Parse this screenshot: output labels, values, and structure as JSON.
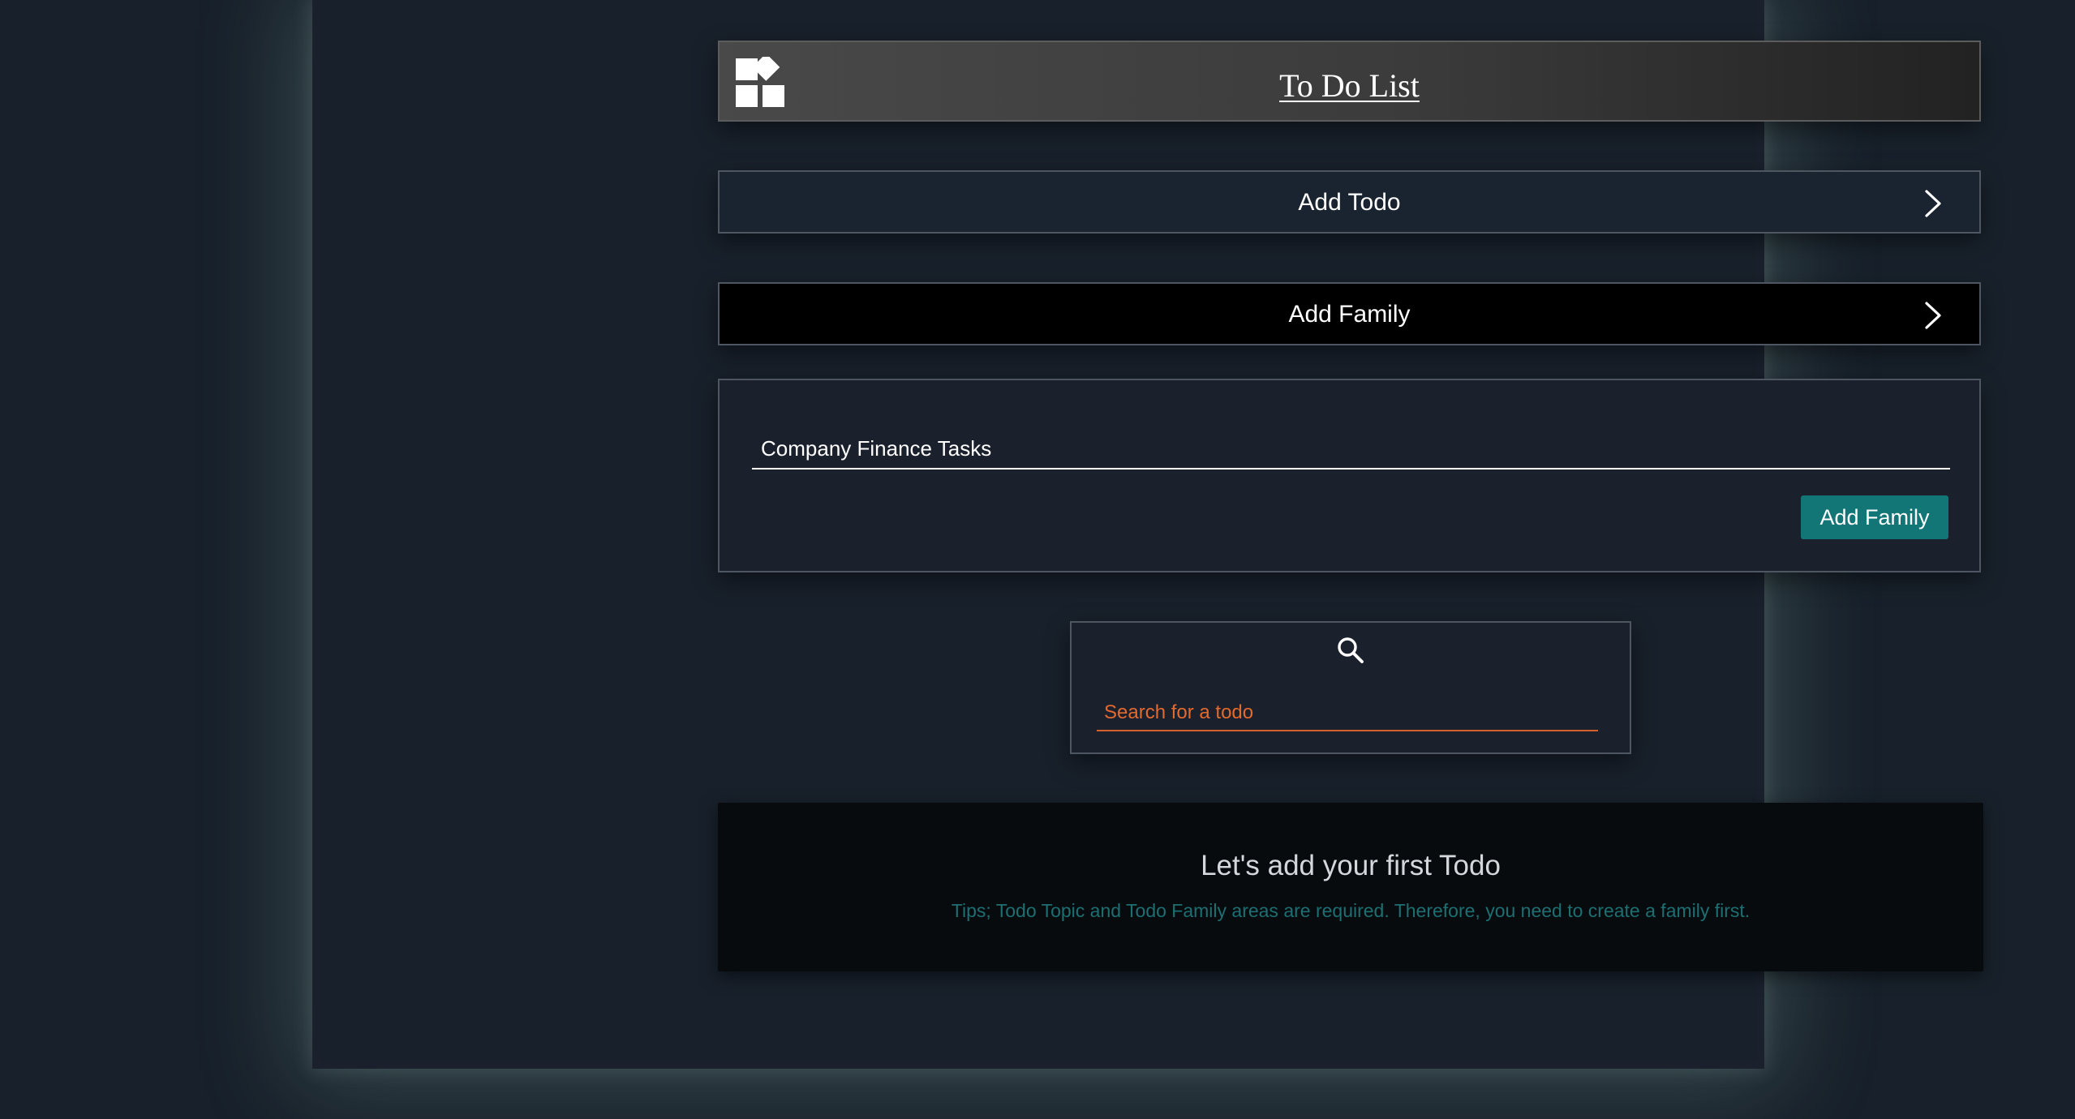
{
  "header": {
    "title": "To Do List",
    "logo_icon": "widgets-icon"
  },
  "accordions": {
    "add_todo": {
      "label": "Add Todo",
      "icon": "chevron-right-icon"
    },
    "add_family": {
      "label": "Add Family",
      "icon": "chevron-right-icon"
    }
  },
  "family_form": {
    "input_value": "Company Finance Tasks",
    "submit_label": "Add Family",
    "submit_color": "#127677"
  },
  "search": {
    "icon": "search-icon",
    "placeholder": "Search for a todo",
    "accent_color": "#e36a2f"
  },
  "empty_state": {
    "title": "Let's add your first Todo",
    "tip": "Tips; Todo Topic and Todo Family areas are required. Therefore, you need to create a family first."
  }
}
